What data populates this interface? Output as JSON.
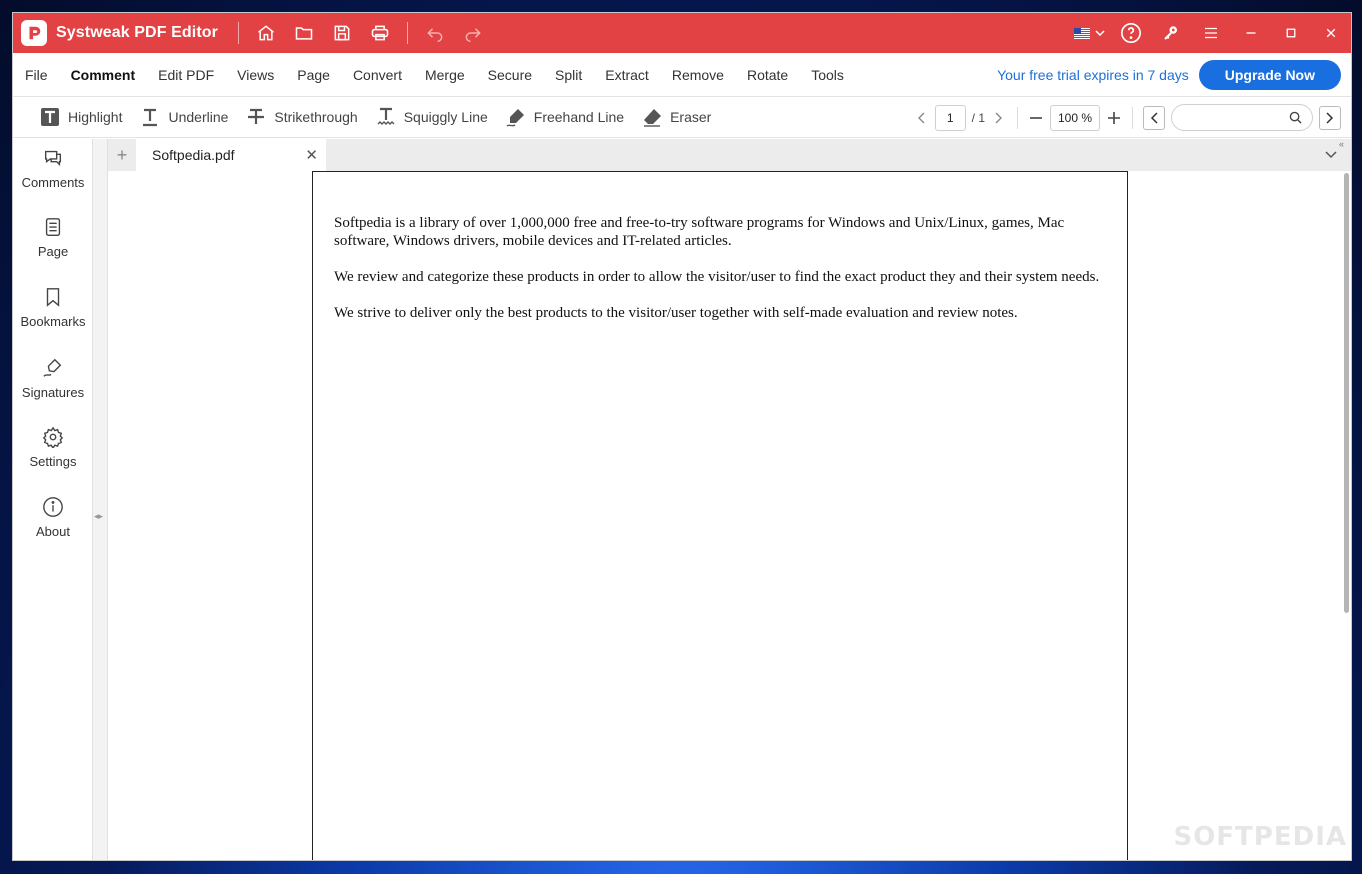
{
  "app": {
    "title": "Systweak PDF Editor"
  },
  "menu": {
    "items": [
      {
        "label": "File",
        "active": false
      },
      {
        "label": "Comment",
        "active": true
      },
      {
        "label": "Edit PDF",
        "active": false
      },
      {
        "label": "Views",
        "active": false
      },
      {
        "label": "Page",
        "active": false
      },
      {
        "label": "Convert",
        "active": false
      },
      {
        "label": "Merge",
        "active": false
      },
      {
        "label": "Secure",
        "active": false
      },
      {
        "label": "Split",
        "active": false
      },
      {
        "label": "Extract",
        "active": false
      },
      {
        "label": "Remove",
        "active": false
      },
      {
        "label": "Rotate",
        "active": false
      },
      {
        "label": "Tools",
        "active": false
      }
    ],
    "trial_text": "Your free trial expires in 7 days",
    "upgrade_label": "Upgrade Now"
  },
  "toolbar": {
    "tools": [
      {
        "label": "Highlight",
        "icon": "highlight-icon"
      },
      {
        "label": "Underline",
        "icon": "underline-icon"
      },
      {
        "label": "Strikethrough",
        "icon": "strikethrough-icon"
      },
      {
        "label": "Squiggly Line",
        "icon": "squiggly-icon"
      },
      {
        "label": "Freehand Line",
        "icon": "freehand-icon"
      },
      {
        "label": "Eraser",
        "icon": "eraser-icon"
      }
    ],
    "page_current": "1",
    "page_total": "/ 1",
    "zoom": "100 %",
    "search_placeholder": ""
  },
  "sidebar": {
    "items": [
      {
        "label": "Comments",
        "icon": "comments-icon"
      },
      {
        "label": "Page",
        "icon": "page-icon"
      },
      {
        "label": "Bookmarks",
        "icon": "bookmark-icon"
      },
      {
        "label": "Signatures",
        "icon": "signature-icon"
      },
      {
        "label": "Settings",
        "icon": "gear-icon"
      },
      {
        "label": "About",
        "icon": "info-icon"
      }
    ]
  },
  "tabs": [
    {
      "label": "Softpedia.pdf"
    }
  ],
  "document": {
    "paragraphs": [
      "Softpedia is a library of over 1,000,000 free and free-to-try software programs for Windows and Unix/Linux, games, Mac software, Windows drivers, mobile devices and IT-related articles.",
      "We review and categorize these products in order to allow the visitor/user to find the exact product they and their system needs.",
      "We strive to deliver only the best products to the visitor/user together with self-made evaluation and review notes."
    ]
  },
  "watermark": "SOFTPEDIA",
  "colors": {
    "titlebar": "#e24243",
    "accent": "#1a6fe0",
    "trial_text": "#1e6fd9"
  }
}
